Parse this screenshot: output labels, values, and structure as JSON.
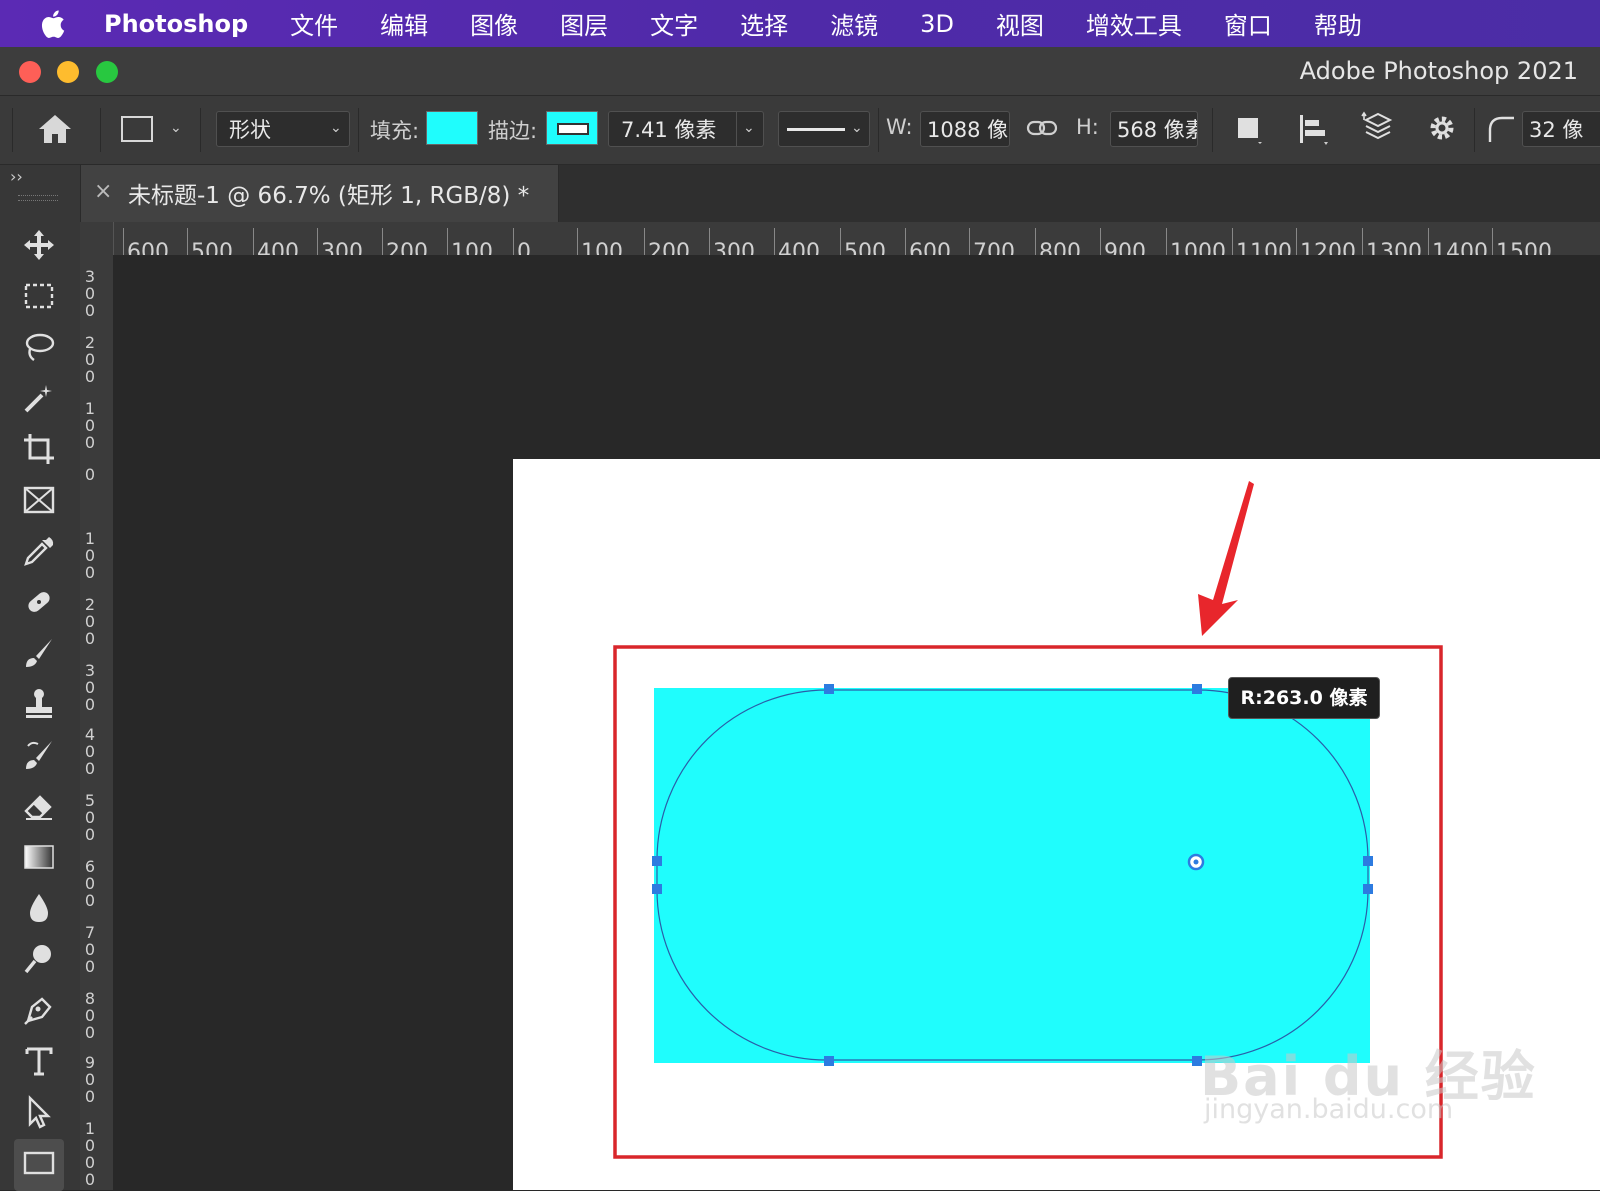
{
  "menu": {
    "app": "Photoshop",
    "items": [
      "文件",
      "编辑",
      "图像",
      "图层",
      "文字",
      "选择",
      "滤镜",
      "3D",
      "视图",
      "增效工具",
      "窗口",
      "帮助"
    ]
  },
  "window": {
    "title": "Adobe Photoshop 2021"
  },
  "options": {
    "mode": "形状",
    "fill_label": "填充:",
    "stroke_label": "描边:",
    "stroke_width": "7.41 像素",
    "w_label": "W:",
    "w_value": "1088 像",
    "h_label": "H:",
    "h_value": "568 像素",
    "radius_value": "32 像",
    "fill_color": "#1ffdfd",
    "stroke_color": "#1ffdfd"
  },
  "tab": {
    "title": "未标题-1 @ 66.7% (矩形 1, RGB/8) *",
    "close": "×"
  },
  "ruler": {
    "h_labels": [
      "600",
      "500",
      "400",
      "300",
      "200",
      "100",
      "0",
      "100",
      "200",
      "300",
      "400",
      "500",
      "600",
      "700",
      "800",
      "900",
      "1000",
      "1100",
      "1200",
      "1300",
      "1400",
      "1500"
    ],
    "v_labels": [
      "300",
      "200",
      "100",
      "0",
      "100",
      "200",
      "300",
      "400",
      "500",
      "600",
      "700",
      "800",
      "900",
      "1000"
    ]
  },
  "canvas": {
    "radius_tooltip": "R:263.0 像素",
    "shape_color": "#1ffdfd",
    "highlight_color": "#d9262b",
    "arrow_color": "#e8262c"
  },
  "watermark": {
    "brand": "Bai du 经验",
    "url": "jingyan.baidu.com"
  },
  "tools": [
    "move-tool-icon",
    "marquee-tool-icon",
    "lasso-tool-icon",
    "magic-wand-icon",
    "crop-tool-icon",
    "frame-tool-icon",
    "eyedropper-icon",
    "healing-brush-icon",
    "brush-tool-icon",
    "clone-stamp-icon",
    "history-brush-icon",
    "eraser-icon",
    "gradient-tool-icon",
    "blur-tool-icon",
    "dodge-tool-icon",
    "pen-tool-icon",
    "type-tool-icon",
    "path-select-icon",
    "rectangle-tool-icon"
  ]
}
